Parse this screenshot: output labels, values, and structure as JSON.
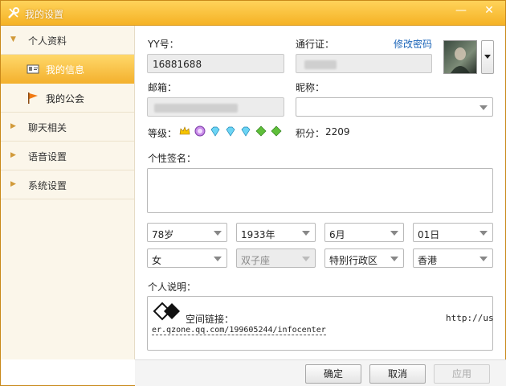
{
  "window": {
    "title": "我的设置",
    "minimize": "—",
    "close": "✕"
  },
  "sidebar": {
    "sections": [
      {
        "label": "个人资料",
        "expanded": true
      },
      {
        "label": "聊天相关",
        "expanded": false
      },
      {
        "label": "语音设置",
        "expanded": false
      },
      {
        "label": "系统设置",
        "expanded": false
      }
    ],
    "subitems": [
      {
        "label": "我的信息",
        "icon": "id-card-icon",
        "active": true
      },
      {
        "label": "我的公会",
        "icon": "flag-icon",
        "active": false
      }
    ]
  },
  "form": {
    "yy_label": "YY号：",
    "yy_value": "16881688",
    "passport_label": "通行证：",
    "change_password": "修改密码",
    "email_label": "邮箱：",
    "nickname_label": "昵称：",
    "nickname_value": "",
    "level_label": "等级：",
    "level_icons": [
      "crown-icon",
      "medal-icon",
      "diamond-icon",
      "diamond-icon",
      "diamond-icon",
      "leaf-icon",
      "leaf-icon"
    ],
    "points_label": "积分：",
    "points_value": "2209",
    "signature_label": "个性签名：",
    "signature_value": "",
    "age": "78岁",
    "year": "1933年",
    "month": "6月",
    "day": "01日",
    "gender": "女",
    "zodiac": "双子座",
    "region": "特别行政区",
    "city": "香港",
    "description_label": "个人说明：",
    "description": {
      "link_label": "空间链接：",
      "url_part1": "http://us",
      "url_part2": "er.qzone.qq.com/199605244/infocenter"
    }
  },
  "footer": {
    "ok": "确定",
    "cancel": "取消",
    "apply": "应用"
  }
}
